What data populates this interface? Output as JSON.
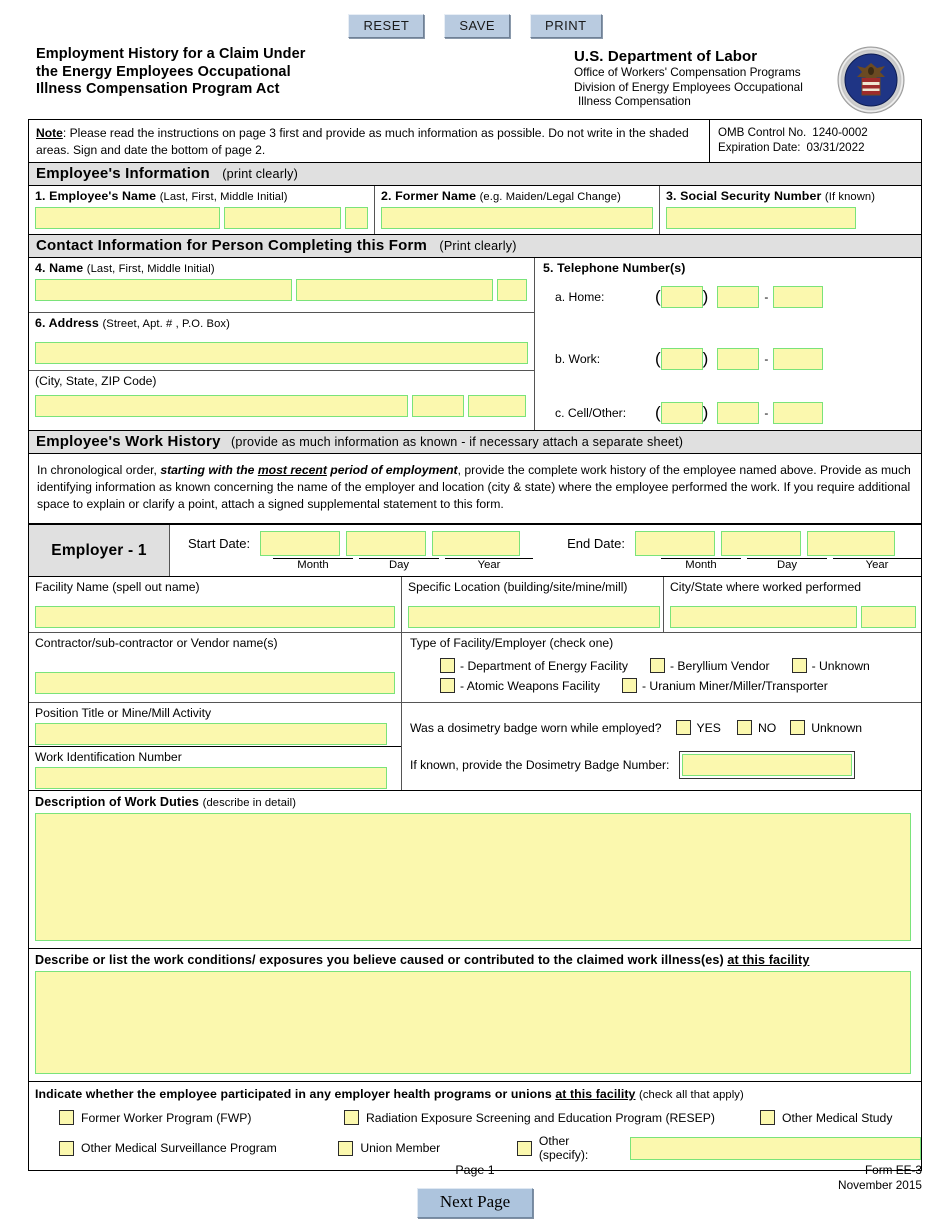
{
  "toolbar": {
    "reset": "RESET",
    "save": "SAVE",
    "print": "PRINT"
  },
  "header": {
    "title_line1": "Employment History for a Claim Under",
    "title_line2": "the Energy Employees Occupational",
    "title_line3": "Illness Compensation Program Act",
    "agency": "U.S. Department of Labor",
    "agency_line1": "Office of Workers' Compensation Programs",
    "agency_line2": "Division of Energy Employees Occupational",
    "agency_line3": "Illness Compensation",
    "seal_alt": "dol-seal-icon"
  },
  "note": {
    "label": "Note",
    "text": ":  Please read the instructions on page 3 first and provide as much information as possible.  Do not write in the shaded areas.  Sign and date the bottom of page 2."
  },
  "omb": {
    "control_label": "OMB Control No.",
    "control_value": "1240-0002",
    "expiration_label": "Expiration Date:",
    "expiration_value": "03/31/2022"
  },
  "employee_info": {
    "band_title": "Employee's Information",
    "band_note": "(print clearly)",
    "field1_label": "1.  Employee's Name",
    "field1_note": "(Last, First, Middle Initial)",
    "field2_label": "2.  Former Name",
    "field2_note": "(e.g. Maiden/Legal Change)",
    "field3_label": "3.  Social Security Number",
    "field3_note": "(If known)"
  },
  "contact": {
    "band_title": "Contact Information for Person Completing this Form",
    "band_note": "(Print clearly)",
    "name_label": "4.  Name",
    "name_note": "(Last, First, Middle Initial)",
    "address_label": "6.  Address",
    "address_note": "(Street, Apt. # , P.O. Box)",
    "city_note": "(City, State, ZIP Code)",
    "phone_label": "5.  Telephone Number(s)",
    "phone_home": "a.  Home:",
    "phone_work": "b.  Work:",
    "phone_cell": "c.  Cell/Other:",
    "paren_open": "(",
    "paren_close": ")",
    "dash": "-"
  },
  "work_history": {
    "band_title": "Employee's Work History",
    "band_note": "(provide as much information as known - if necessary attach a separate sheet)",
    "intro_a": "In chronological order, ",
    "intro_b": "starting with the ",
    "intro_c": "most recent",
    "intro_d": " period of employment",
    "intro_e": ", provide the complete work history of the employee named above.  Provide as much identifying information as known concerning the name of the employer and location (city & state) where the employee performed the work.  If you require additional space to explain or clarify a point, attach a signed supplemental statement to this form."
  },
  "employer": {
    "tag": "Employer - 1",
    "start_label": "Start Date:",
    "end_label": "End Date:",
    "cap_month": "Month",
    "cap_day": "Day",
    "cap_year": "Year",
    "facility_name_label": "Facility Name (spell out name)",
    "specific_location_label": "Specific Location (building/site/mine/mill)",
    "city_state_label": "City/State where worked performed",
    "contractor_label": "Contractor/sub-contractor or Vendor name(s)",
    "facility_type_label": "Type of Facility/Employer (check one)",
    "type_doe": "- Department of Energy Facility",
    "type_beryllium": "- Beryllium Vendor",
    "type_unknown": "- Unknown",
    "type_atomic": "- Atomic Weapons Facility",
    "type_uranium": "- Uranium Miner/Miller/Transporter",
    "position_label": "Position Title or Mine/Mill Activity",
    "workid_label": "Work Identification Number",
    "dosimetry_question": "Was a dosimetry badge worn while employed?",
    "dosimetry_yes": "YES",
    "dosimetry_no": "NO",
    "dosimetry_unknown": "Unknown",
    "badge_number_label": "If known, provide the Dosimetry Badge Number:",
    "duties_label": "Description of Work Duties",
    "duties_note": "(describe in detail)",
    "exposures_label_a": "Describe or list the work conditions/ exposures you believe caused or contributed to the claimed work illness(es) ",
    "exposures_label_b": "at this facility",
    "programs_label_a": "Indicate whether the employee participated in any employer health programs or unions ",
    "programs_label_b": "at this facility",
    "programs_note": "(check all that apply)",
    "prog_fwp": "Former Worker Program (FWP)",
    "prog_resep": "Radiation Exposure Screening and Education Program (RESEP)",
    "prog_other_study": "Other Medical Study",
    "prog_surveillance": "Other Medical Surveillance Program",
    "prog_union": "Union Member",
    "prog_other": "Other (specify):"
  },
  "footer": {
    "page": "Page 1",
    "form_no": "Form EE-3",
    "form_date": "November 2015",
    "next_page": "Next Page"
  }
}
